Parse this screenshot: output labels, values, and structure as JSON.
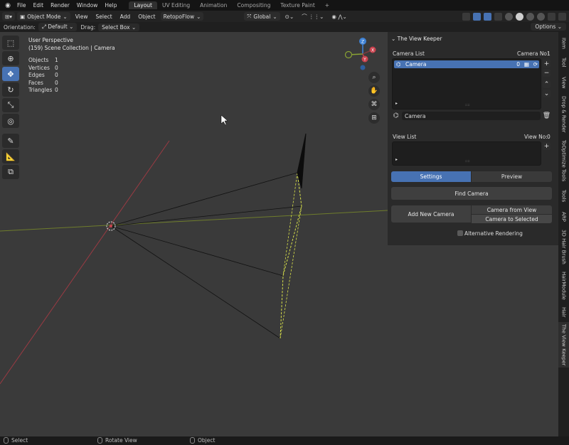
{
  "topbar": {
    "menus": [
      "File",
      "Edit",
      "Render",
      "Window",
      "Help"
    ],
    "workspaces": [
      "Layout",
      "UV Editing",
      "Animation",
      "Compositing",
      "Texture Paint"
    ],
    "active_workspace": "Layout",
    "add_workspace": "+"
  },
  "header": {
    "mode": "Object Mode",
    "menus": [
      "View",
      "Select",
      "Add",
      "Object"
    ],
    "addon_menu": "RetopoFlow",
    "transform_orientation": "Global"
  },
  "toolrow": {
    "orientation_label": "Orientation:",
    "orientation_value": "Default",
    "drag_label": "Drag:",
    "drag_value": "Select Box",
    "options_label": "Options"
  },
  "viewport": {
    "perspective": "User Perspective",
    "collection": "(159) Scene Collection | Camera",
    "stats": [
      {
        "label": "Objects",
        "value": "1"
      },
      {
        "label": "Vertices",
        "value": "0"
      },
      {
        "label": "Edges",
        "value": "0"
      },
      {
        "label": "Faces",
        "value": "0"
      },
      {
        "label": "Triangles",
        "value": "0"
      }
    ],
    "gizmo": {
      "z": "Z",
      "y": "Y",
      "x": "X"
    }
  },
  "panel": {
    "title": "The View Keeper",
    "camera_list_label": "Camera List",
    "camera_no_label": "Camera No:",
    "camera_no_value": "1",
    "camera_row_name": "Camera",
    "camera_row_index": "0",
    "camera_name_field": "Camera",
    "view_list_label": "View List",
    "view_no_label": "View No:",
    "view_no_value": "0",
    "tab_settings": "Settings",
    "tab_preview": "Preview",
    "find_camera": "Find Camera",
    "add_new_camera": "Add New Camera",
    "camera_from_view": "Camera from View",
    "camera_to_selected": "Camera to Selected",
    "alternative_rendering": "Alternative Rendering",
    "plus": "+",
    "minus": "−",
    "grip": "::::"
  },
  "side_tabs": [
    "Item",
    "Tool",
    "View",
    "Drop & Render",
    "ToOptimize Tools",
    "Tools",
    "ARP",
    "3D Hair Brush",
    "HairModule",
    "Hair",
    "The View Keeper"
  ],
  "active_side_tab": "The View Keeper",
  "statusbar": {
    "select": "Select",
    "rotate": "Rotate View",
    "object": "Object"
  },
  "colors": {
    "accent": "#4772b3",
    "x_axis": "#c9434f",
    "y_axis": "#8aa334",
    "z_axis": "#3f82d6",
    "camera_frame": "#d9e24a"
  }
}
